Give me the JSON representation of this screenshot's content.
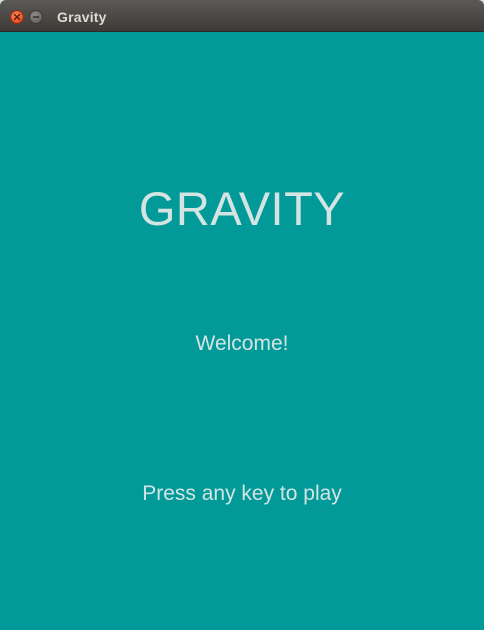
{
  "window": {
    "title": "Gravity"
  },
  "icons": {
    "close": "close-icon",
    "minimize": "minimize-icon"
  },
  "colors": {
    "background": "#019a98",
    "text": "#d4e4e2",
    "titlebar": "#4a4945",
    "close_button": "#ed5a2f"
  },
  "screen": {
    "game_title": "GRAVITY",
    "welcome": "Welcome!",
    "prompt": "Press any key to play"
  }
}
